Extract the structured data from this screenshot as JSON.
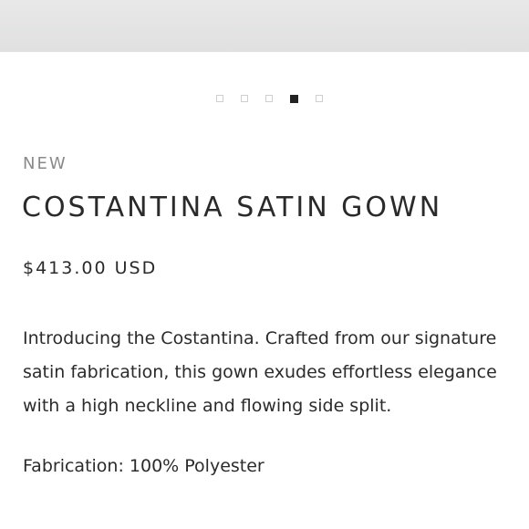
{
  "gallery": {
    "dot_count": 5,
    "active_index": 3
  },
  "product": {
    "badge": "NEW",
    "title": "COSTANTINA SATIN GOWN",
    "price": "$413.00 USD",
    "description": "Introducing the Costantina. Crafted from our signature satin fabrication, this gown exudes effortless elegance with a high neckline and flowing side split.",
    "fabrication": "Fabrication: 100% Polyester"
  },
  "colors": {
    "active_dot": "#222222",
    "inactive_dot_border": "#cfcfcf",
    "badge_text": "#8a8a8a",
    "body_text": "#2b2b2b"
  }
}
